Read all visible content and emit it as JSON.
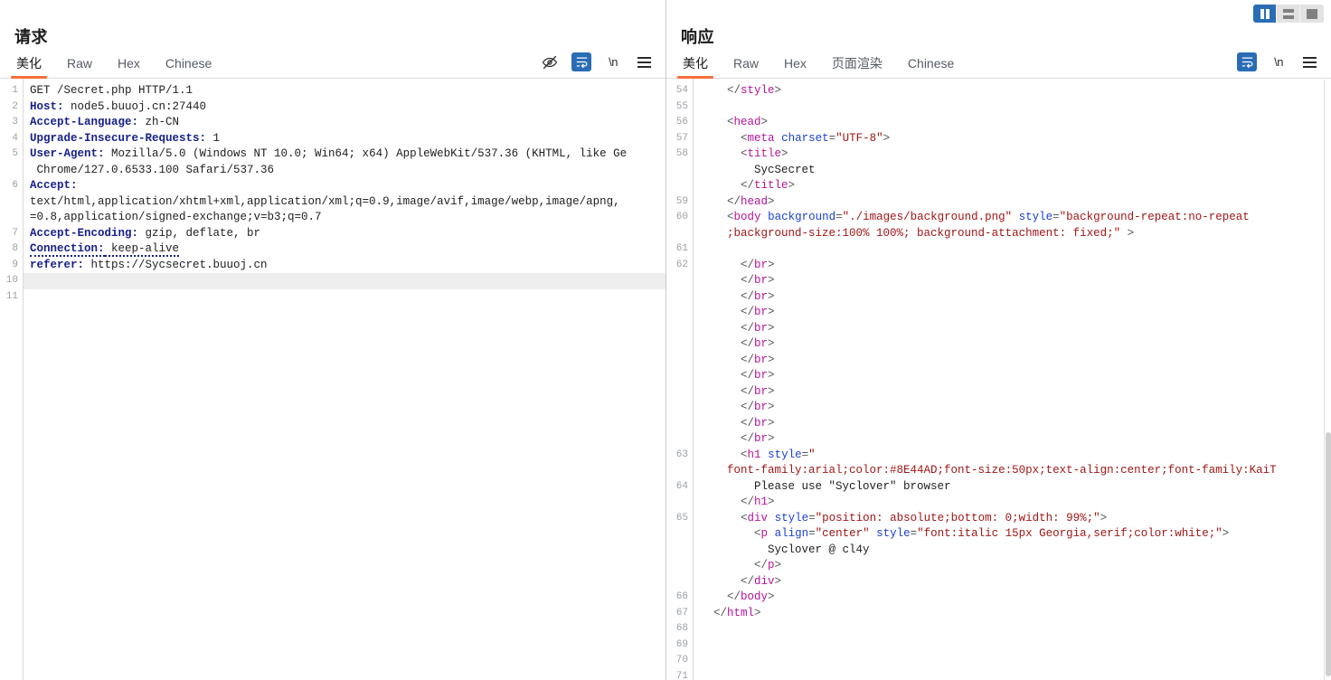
{
  "layout_toggles": [
    {
      "name": "vertical-split",
      "active": true
    },
    {
      "name": "horizontal-split",
      "active": false
    },
    {
      "name": "single-pane",
      "active": false
    }
  ],
  "request": {
    "title": "请求",
    "tabs": [
      {
        "label": "美化",
        "active": true
      },
      {
        "label": "Raw",
        "active": false
      },
      {
        "label": "Hex",
        "active": false
      },
      {
        "label": "Chinese",
        "active": false
      }
    ],
    "tools": [
      {
        "name": "eye-slash-icon",
        "label": "",
        "active": false
      },
      {
        "name": "word-wrap-icon",
        "label": "",
        "active": true
      },
      {
        "name": "newline-icon",
        "label": "\\n",
        "active": false
      },
      {
        "name": "menu-icon",
        "label": "",
        "active": false
      }
    ],
    "line_numbers": [
      "1",
      "2",
      "3",
      "4",
      "5",
      "",
      "6",
      "",
      "",
      "7",
      "8",
      "9",
      "10",
      "11"
    ],
    "lines": [
      {
        "n": "1",
        "type": "start",
        "method": "GET /Secret.php HTTP/1.1"
      },
      {
        "n": "2",
        "type": "header",
        "key": "Host",
        "value": " node5.buuoj.cn:27440"
      },
      {
        "n": "3",
        "type": "header",
        "key": "Accept-Language",
        "value": " zh-CN"
      },
      {
        "n": "4",
        "type": "header",
        "key": "Upgrade-Insecure-Requests",
        "value": " 1"
      },
      {
        "n": "5",
        "type": "header",
        "key": "User-Agent",
        "value": " Mozilla/5.0 (Windows NT 10.0; Win64; x64) AppleWebKit/537.36 (KHTML, like Ge"
      },
      {
        "n": "",
        "type": "cont",
        "value": " Chrome/127.0.6533.100 Safari/537.36"
      },
      {
        "n": "6",
        "type": "header",
        "key": "Accept",
        "value": ""
      },
      {
        "n": "",
        "type": "cont",
        "value": "text/html,application/xhtml+xml,application/xml;q=0.9,image/avif,image/webp,image/apng,"
      },
      {
        "n": "",
        "type": "cont",
        "value": "=0.8,application/signed-exchange;v=b3;q=0.7"
      },
      {
        "n": "7",
        "type": "header",
        "key": "Accept-Encoding",
        "value": " gzip, deflate, br"
      },
      {
        "n": "8",
        "type": "header-dotted",
        "key": "Connection",
        "value": " keep-alive"
      },
      {
        "n": "9",
        "type": "header",
        "key": "referer",
        "value": " https://Sycsecret.buuoj.cn"
      },
      {
        "n": "10",
        "type": "empty-highlighted",
        "value": ""
      },
      {
        "n": "11",
        "type": "empty",
        "value": ""
      }
    ]
  },
  "response": {
    "title": "响应",
    "tabs": [
      {
        "label": "美化",
        "active": true
      },
      {
        "label": "Raw",
        "active": false
      },
      {
        "label": "Hex",
        "active": false
      },
      {
        "label": "页面渲染",
        "active": false
      },
      {
        "label": "Chinese",
        "active": false
      }
    ],
    "tools": [
      {
        "name": "word-wrap-icon",
        "label": "",
        "active": true
      },
      {
        "name": "newline-icon",
        "label": "\\n",
        "active": false
      },
      {
        "name": "menu-icon",
        "label": "",
        "active": false
      }
    ],
    "lines": [
      {
        "n": "54",
        "indent": 2,
        "html": "<span class=\"brk\">&lt;/</span><span class=\"tag\">style</span><span class=\"brk\">&gt;</span>"
      },
      {
        "n": "55",
        "indent": 0,
        "html": ""
      },
      {
        "n": "56",
        "indent": 2,
        "html": "<span class=\"brk\">&lt;</span><span class=\"tag\">head</span><span class=\"brk\">&gt;</span>"
      },
      {
        "n": "57",
        "indent": 3,
        "html": "<span class=\"brk\">&lt;</span><span class=\"tag\">meta</span> <span class=\"attr\">charset</span><span class=\"brk\">=</span><span class=\"str\">\"UTF-8\"</span><span class=\"brk\">&gt;</span>"
      },
      {
        "n": "58",
        "indent": 3,
        "html": "<span class=\"brk\">&lt;</span><span class=\"tag\">title</span><span class=\"brk\">&gt;</span>"
      },
      {
        "n": "",
        "indent": 4,
        "html": "<span class=\"txt\">SycSecret</span>"
      },
      {
        "n": "",
        "indent": 3,
        "html": "<span class=\"brk\">&lt;/</span><span class=\"tag\">title</span><span class=\"brk\">&gt;</span>"
      },
      {
        "n": "59",
        "indent": 2,
        "html": "<span class=\"brk\">&lt;/</span><span class=\"tag\">head</span><span class=\"brk\">&gt;</span>"
      },
      {
        "n": "60",
        "indent": 2,
        "html": "<span class=\"brk\">&lt;</span><span class=\"tag\">body</span> <span class=\"attr\">background</span><span class=\"brk\">=</span><span class=\"str\">\"./images/background.png\"</span> <span class=\"attr\">style</span><span class=\"brk\">=</span><span class=\"str\">\"background-repeat:no-repeat</span>"
      },
      {
        "n": "",
        "indent": 2,
        "html": "<span class=\"str\">;background-size:100% 100%; background-attachment: fixed;\"</span> <span class=\"brk\">&gt;</span>"
      },
      {
        "n": "61",
        "indent": 0,
        "html": ""
      },
      {
        "n": "62",
        "indent": 3,
        "html": "<span class=\"brk\">&lt;/</span><span class=\"tag\">br</span><span class=\"brk\">&gt;</span>"
      },
      {
        "n": "",
        "indent": 3,
        "html": "<span class=\"brk\">&lt;/</span><span class=\"tag\">br</span><span class=\"brk\">&gt;</span>"
      },
      {
        "n": "",
        "indent": 3,
        "html": "<span class=\"brk\">&lt;/</span><span class=\"tag\">br</span><span class=\"brk\">&gt;</span>"
      },
      {
        "n": "",
        "indent": 3,
        "html": "<span class=\"brk\">&lt;/</span><span class=\"tag\">br</span><span class=\"brk\">&gt;</span>"
      },
      {
        "n": "",
        "indent": 3,
        "html": "<span class=\"brk\">&lt;/</span><span class=\"tag\">br</span><span class=\"brk\">&gt;</span>"
      },
      {
        "n": "",
        "indent": 3,
        "html": "<span class=\"brk\">&lt;/</span><span class=\"tag\">br</span><span class=\"brk\">&gt;</span>"
      },
      {
        "n": "",
        "indent": 3,
        "html": "<span class=\"brk\">&lt;/</span><span class=\"tag\">br</span><span class=\"brk\">&gt;</span>"
      },
      {
        "n": "",
        "indent": 3,
        "html": "<span class=\"brk\">&lt;/</span><span class=\"tag\">br</span><span class=\"brk\">&gt;</span>"
      },
      {
        "n": "",
        "indent": 3,
        "html": "<span class=\"brk\">&lt;/</span><span class=\"tag\">br</span><span class=\"brk\">&gt;</span>"
      },
      {
        "n": "",
        "indent": 3,
        "html": "<span class=\"brk\">&lt;/</span><span class=\"tag\">br</span><span class=\"brk\">&gt;</span>"
      },
      {
        "n": "",
        "indent": 3,
        "html": "<span class=\"brk\">&lt;/</span><span class=\"tag\">br</span><span class=\"brk\">&gt;</span>"
      },
      {
        "n": "",
        "indent": 3,
        "html": "<span class=\"brk\">&lt;/</span><span class=\"tag\">br</span><span class=\"brk\">&gt;</span>"
      },
      {
        "n": "63",
        "indent": 3,
        "html": "<span class=\"brk\">&lt;</span><span class=\"tag\">h1</span> <span class=\"attr\">style</span><span class=\"brk\">=</span><span class=\"str\">\"</span>"
      },
      {
        "n": "",
        "indent": 2,
        "html": "<span class=\"str\">font-family:arial;color:#8E44AD;font-size:50px;text-align:center;font-family:KaiT</span>"
      },
      {
        "n": "64",
        "indent": 4,
        "html": "<span class=\"txt\">Please use \"Syclover\" browser</span>"
      },
      {
        "n": "",
        "indent": 3,
        "html": "<span class=\"brk\">&lt;/</span><span class=\"tag\">h1</span><span class=\"brk\">&gt;</span>"
      },
      {
        "n": "65",
        "indent": 3,
        "html": "<span class=\"brk\">&lt;</span><span class=\"tag\">div</span> <span class=\"attr\">style</span><span class=\"brk\">=</span><span class=\"str\">\"position: absolute;bottom: 0;width: 99%;\"</span><span class=\"brk\">&gt;</span>"
      },
      {
        "n": "",
        "indent": 4,
        "html": "<span class=\"brk\">&lt;</span><span class=\"tag\">p</span> <span class=\"attr\">align</span><span class=\"brk\">=</span><span class=\"str\">\"center\"</span> <span class=\"attr\">style</span><span class=\"brk\">=</span><span class=\"str\">\"font:italic 15px Georgia,serif;color:white;\"</span><span class=\"brk\">&gt;</span>"
      },
      {
        "n": "",
        "indent": 5,
        "html": "<span class=\"txt\">Syclover @ cl4y</span>"
      },
      {
        "n": "",
        "indent": 4,
        "html": "<span class=\"brk\">&lt;/</span><span class=\"tag\">p</span><span class=\"brk\">&gt;</span>"
      },
      {
        "n": "",
        "indent": 3,
        "html": "<span class=\"brk\">&lt;/</span><span class=\"tag\">div</span><span class=\"brk\">&gt;</span>"
      },
      {
        "n": "66",
        "indent": 2,
        "html": "<span class=\"brk\">&lt;/</span><span class=\"tag\">body</span><span class=\"brk\">&gt;</span>"
      },
      {
        "n": "67",
        "indent": 1,
        "html": "<span class=\"brk\">&lt;/</span><span class=\"tag\">html</span><span class=\"brk\">&gt;</span>"
      },
      {
        "n": "68",
        "indent": 0,
        "html": ""
      },
      {
        "n": "69",
        "indent": 0,
        "html": ""
      },
      {
        "n": "70",
        "indent": 0,
        "html": ""
      },
      {
        "n": "71",
        "indent": 0,
        "html": ""
      }
    ]
  }
}
